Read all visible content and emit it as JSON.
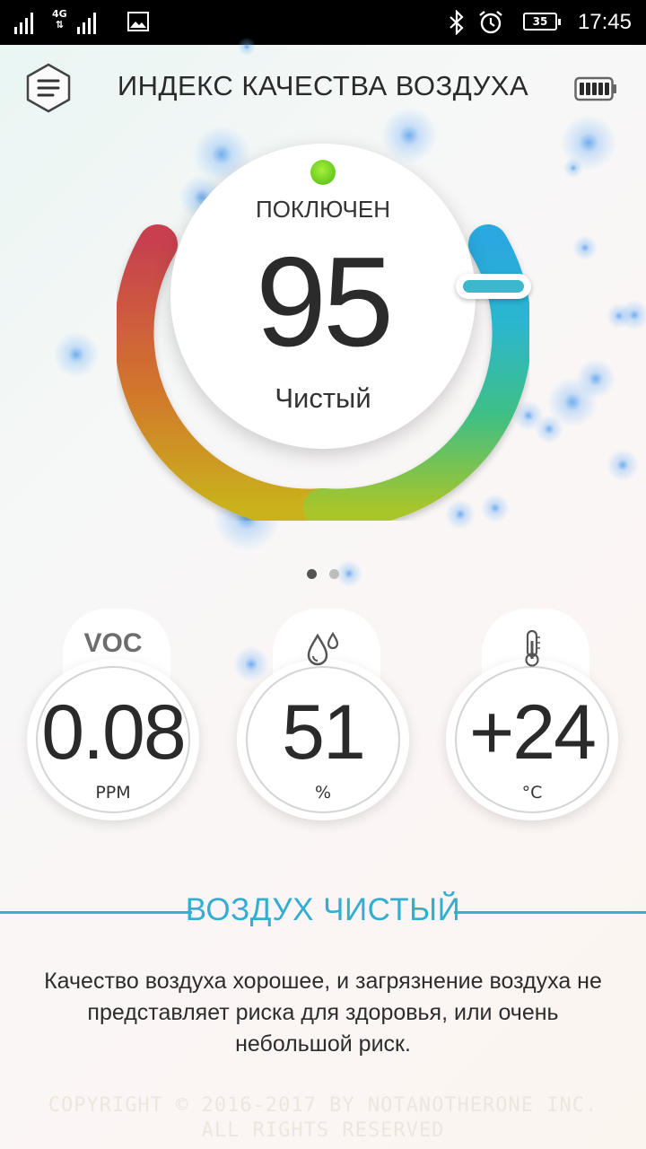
{
  "status_bar": {
    "network": "4G",
    "battery_level": "35",
    "time": "17:45",
    "icons": [
      "signal-icon",
      "signal-icon",
      "image-icon",
      "bluetooth-icon",
      "alarm-icon",
      "battery-icon"
    ]
  },
  "header": {
    "title": "ИНДЕКС КАЧЕСТВА ВОЗДУХА",
    "menu_icon": "menu-icon",
    "device_battery_icon": "device-battery-icon"
  },
  "gauge": {
    "connection_status": "ПОКЛЮЧЕН",
    "status_color": "#6ad31f",
    "aqi_value": "95",
    "aqi_label": "Чистый"
  },
  "pager": {
    "pages": 2,
    "active": 1
  },
  "sensors": [
    {
      "id": "voc",
      "title": "VOC",
      "value": "0.08",
      "unit": "PPM"
    },
    {
      "id": "humidity",
      "icon": "humidity-icon",
      "value": "51",
      "unit": "%"
    },
    {
      "id": "temperature",
      "icon": "thermometer-icon",
      "value": "+24",
      "unit": "°C"
    }
  ],
  "verdict": {
    "title": "ВОЗДУХ ЧИСТЫЙ",
    "description": "Качество воздуха хорошее, и загрязнение воздуха не представляет риска для здоровья, или очень небольшой риск.",
    "accent_color": "#33aed3"
  },
  "footer": {
    "copyright": "COPYRIGHT © 2016-2017 BY NOTANOTHERONE INC. ALL RIGHTS RESERVED"
  }
}
